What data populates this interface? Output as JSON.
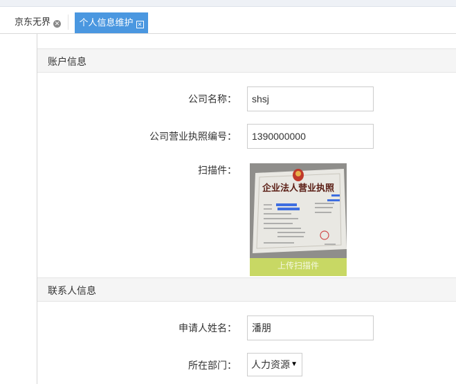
{
  "tabs": [
    {
      "label": "京东无界",
      "active": false
    },
    {
      "label": "个人信息维护",
      "active": true
    }
  ],
  "sections": {
    "account": {
      "title": "账户信息"
    },
    "contact": {
      "title": "联系人信息"
    }
  },
  "account": {
    "company_name_label": "公司名称：",
    "company_name_value": "shsj",
    "license_no_label": "公司营业执照编号：",
    "license_no_value": "1390000000",
    "scan_label": "扫描件：",
    "scan_image_text": "企业法人营业执照",
    "upload_label": "上传扫描件"
  },
  "contact": {
    "applicant_label": "申请人姓名：",
    "applicant_value": "潘朋",
    "dept_label": "所在部门：",
    "dept_value": "人力资源"
  },
  "colors": {
    "accent": "#4a97e0",
    "upload_bg": "#c8d864",
    "section_bg": "#f5f5f5"
  }
}
